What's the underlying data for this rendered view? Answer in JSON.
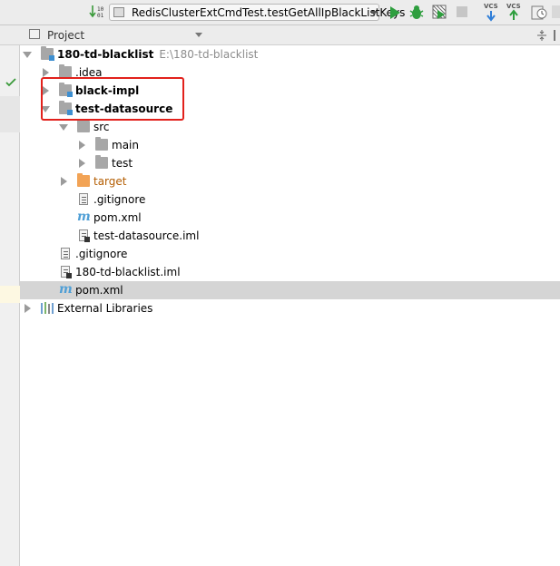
{
  "toolbar": {
    "run_config": "RedisClusterExtCmdTest.testGetAllIpBlackListKeys",
    "sort_icon_text": "10\n01",
    "vcs1": "VCS",
    "vcs2": "VCS"
  },
  "panel": {
    "title": "Project"
  },
  "tree": {
    "root": {
      "name": "180-td-blacklist",
      "path": "E:\\180-td-blacklist"
    },
    "idea": ".idea",
    "black_impl": "black-impl",
    "test_datasource": "test-datasource",
    "src": "src",
    "main": "main",
    "test": "test",
    "target": "target",
    "gitignore_inner": ".gitignore",
    "pom_inner": "pom.xml",
    "iml_inner": "test-datasource.iml",
    "gitignore_root": ".gitignore",
    "iml_root": "180-td-blacklist.iml",
    "pom_root": "pom.xml",
    "external": "External Libraries"
  },
  "colors": {
    "highlight": "#e2211c",
    "selection": "#d5d5d5",
    "module_blue": "#3d8fd1",
    "target_orange": "#f2a355"
  }
}
